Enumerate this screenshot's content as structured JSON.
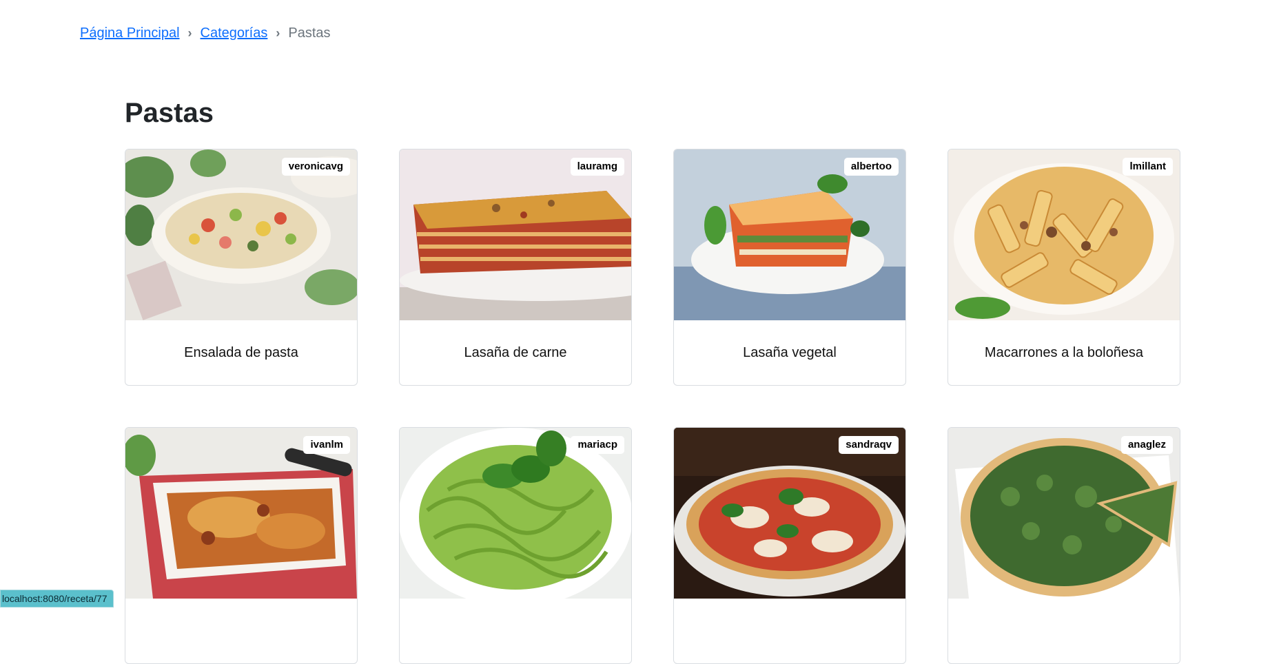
{
  "breadcrumb": {
    "home": "Página Principal",
    "categories": "Categorías",
    "current": "Pastas",
    "separator": "›"
  },
  "page": {
    "title": "Pastas"
  },
  "recipes": [
    {
      "title": "Ensalada de pasta",
      "author": "veronicavg",
      "image": "pasta-salad"
    },
    {
      "title": "Lasaña de carne",
      "author": "lauramg",
      "image": "meat-lasagna"
    },
    {
      "title": "Lasaña vegetal",
      "author": "albertoo",
      "image": "vegetable-lasagna"
    },
    {
      "title": "Macarrones a la boloñesa",
      "author": "lmillant",
      "image": "macaroni-bolognese"
    },
    {
      "title": "",
      "author": "ivanlm",
      "image": "baked-pasta"
    },
    {
      "title": "",
      "author": "mariacp",
      "image": "pesto-pasta"
    },
    {
      "title": "",
      "author": "sandraqv",
      "image": "pizza-margherita"
    },
    {
      "title": "",
      "author": "anaglez",
      "image": "spinach-quiche"
    }
  ],
  "status_bar": {
    "url": "localhost:8080/receta/77"
  },
  "colors": {
    "link": "#0d6efd",
    "status_bar": "#5bc0cc",
    "border": "#d9dde1"
  }
}
